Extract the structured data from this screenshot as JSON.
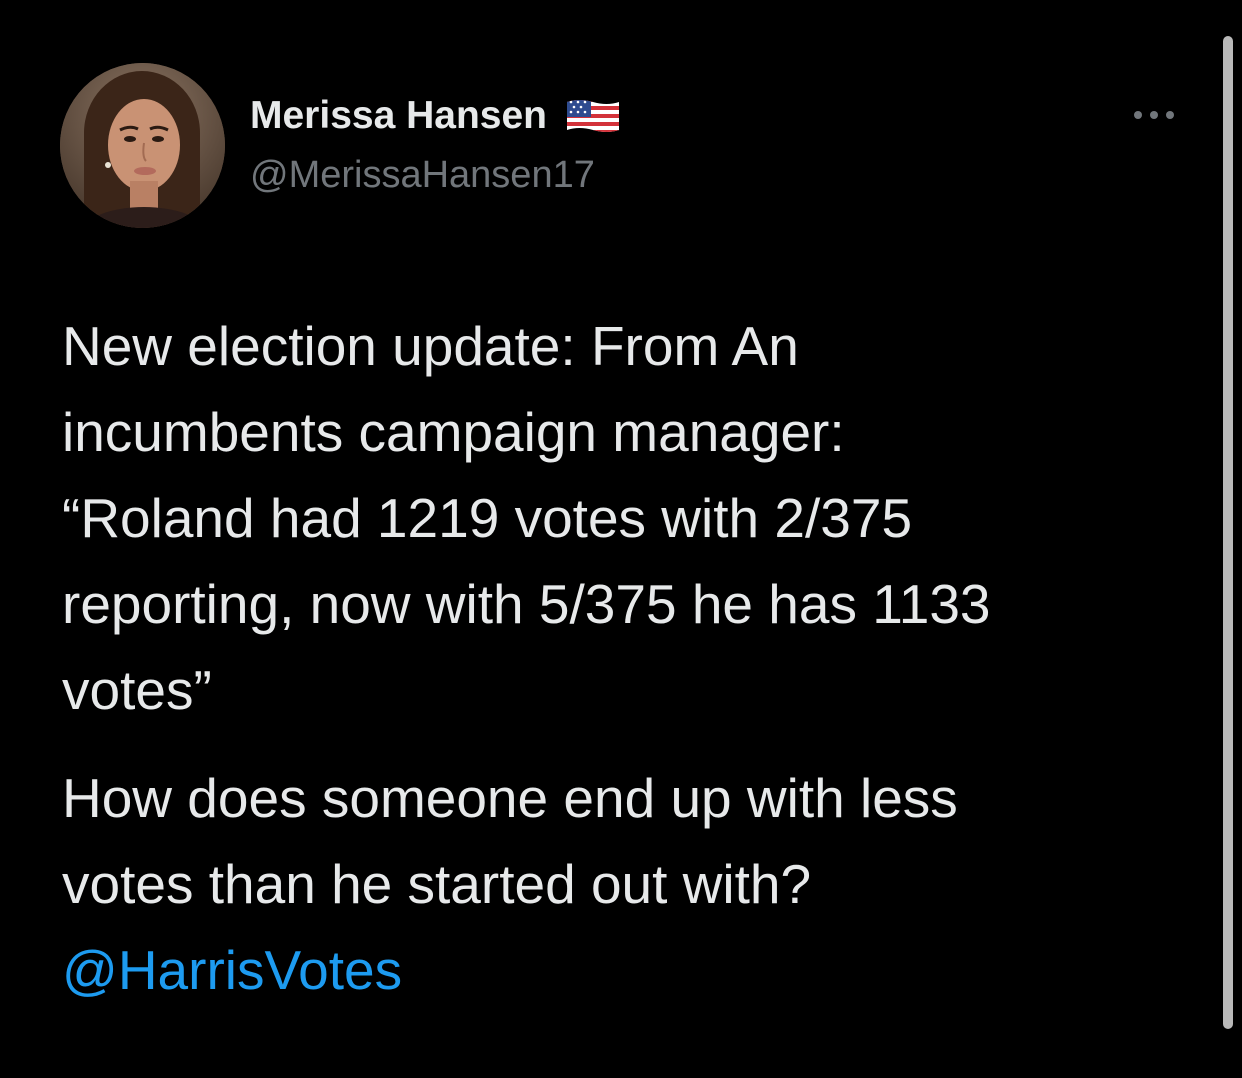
{
  "tweet": {
    "author": {
      "display_name": "Merissa Hansen",
      "handle": "@MerissaHansen17",
      "flag_icon": "us-flag-icon",
      "avatar": "profile-photo"
    },
    "more_icon": "more-dots-icon",
    "paragraph_1": "New election update: From An\nincumbents campaign manager:\n“Roland had 1219 votes with 2/375\nreporting, now with 5/375 he has 1133\nvotes”",
    "paragraph_2": "How does someone end up with less\nvotes than he started out with?",
    "mention": "@HarrisVotes"
  },
  "colors": {
    "background": "#000000",
    "text": "#e7e9ea",
    "secondary_text": "#71767b",
    "link": "#1d9bf0"
  }
}
